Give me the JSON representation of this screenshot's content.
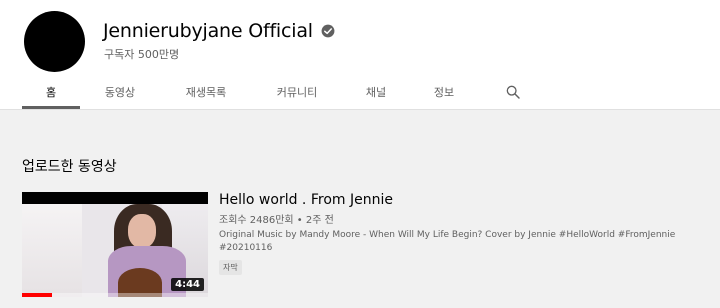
{
  "channel": {
    "name": "Jennierubyjane Official",
    "subscribers": "구독자 500만명",
    "verified_icon": "verified-check-icon"
  },
  "tabs": [
    {
      "label": "홈",
      "active": true
    },
    {
      "label": "동영상",
      "active": false
    },
    {
      "label": "재생목록",
      "active": false
    },
    {
      "label": "커뮤니티",
      "active": false
    },
    {
      "label": "채널",
      "active": false
    },
    {
      "label": "정보",
      "active": false
    }
  ],
  "search_icon": "search-icon",
  "section": {
    "title": "업로드한 동영상"
  },
  "video": {
    "title": "Hello world . From Jennie",
    "meta": "조회수 2486만회 • 2주 전",
    "description": "Original Music by Mandy Moore - When Will My Life Begin? Cover by Jennie #HelloWorld #FromJennie #20210116",
    "badge": "자막",
    "duration": "4:44",
    "progress": 0.16
  },
  "colors": {
    "accent": "#ff0000",
    "background": "#f1f1f1",
    "header": "#ffffff"
  }
}
